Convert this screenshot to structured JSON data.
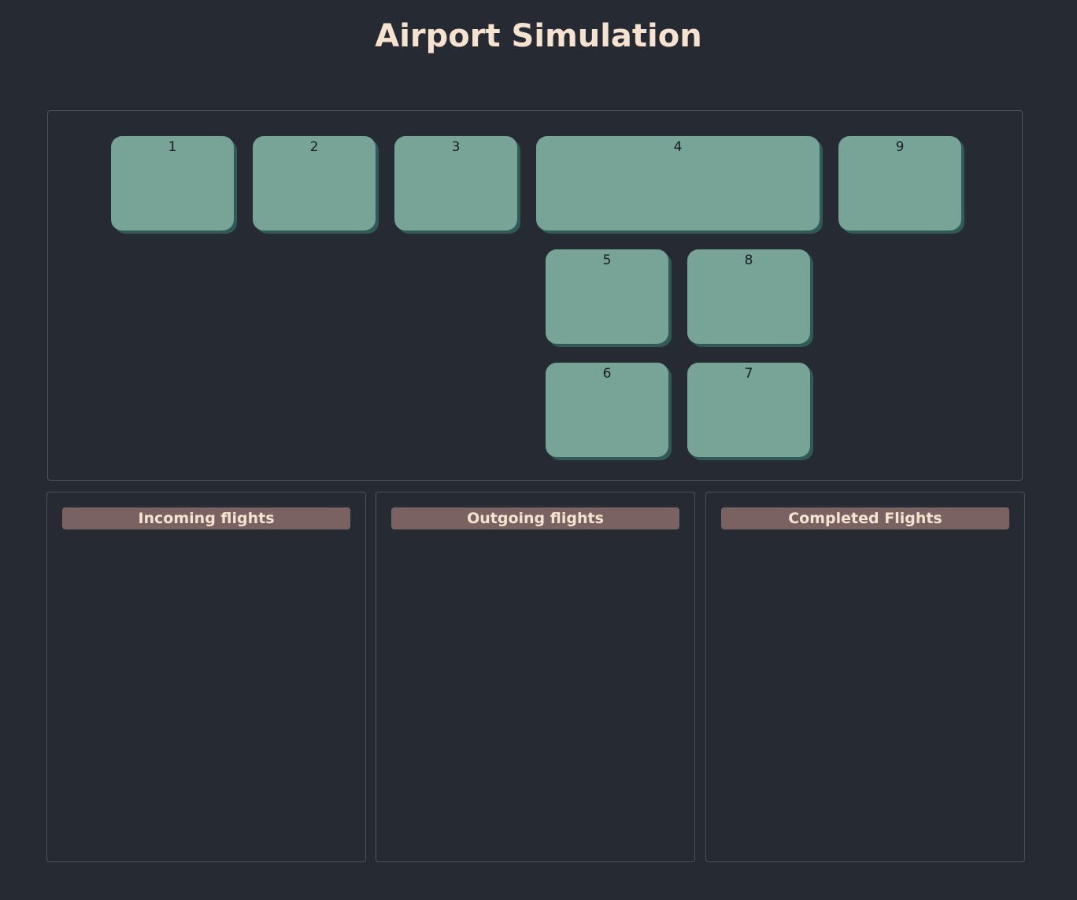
{
  "page": {
    "title": "Airport Simulation"
  },
  "colors": {
    "background": "#262a33",
    "title": "#f6e3cf",
    "gate_fill": "#78a397",
    "gate_shadow": "#2f5a55",
    "panel_border": "#4d525c",
    "list_header_fill": "#7b6262"
  },
  "gates": [
    {
      "label": "1"
    },
    {
      "label": "2"
    },
    {
      "label": "3"
    },
    {
      "label": "4"
    },
    {
      "label": "9"
    },
    {
      "label": "5"
    },
    {
      "label": "8"
    },
    {
      "label": "6"
    },
    {
      "label": "7"
    }
  ],
  "panels": {
    "incoming": {
      "title": "Incoming flights",
      "items": []
    },
    "outgoing": {
      "title": "Outgoing flights",
      "items": []
    },
    "completed": {
      "title": "Completed Flights",
      "items": []
    }
  }
}
